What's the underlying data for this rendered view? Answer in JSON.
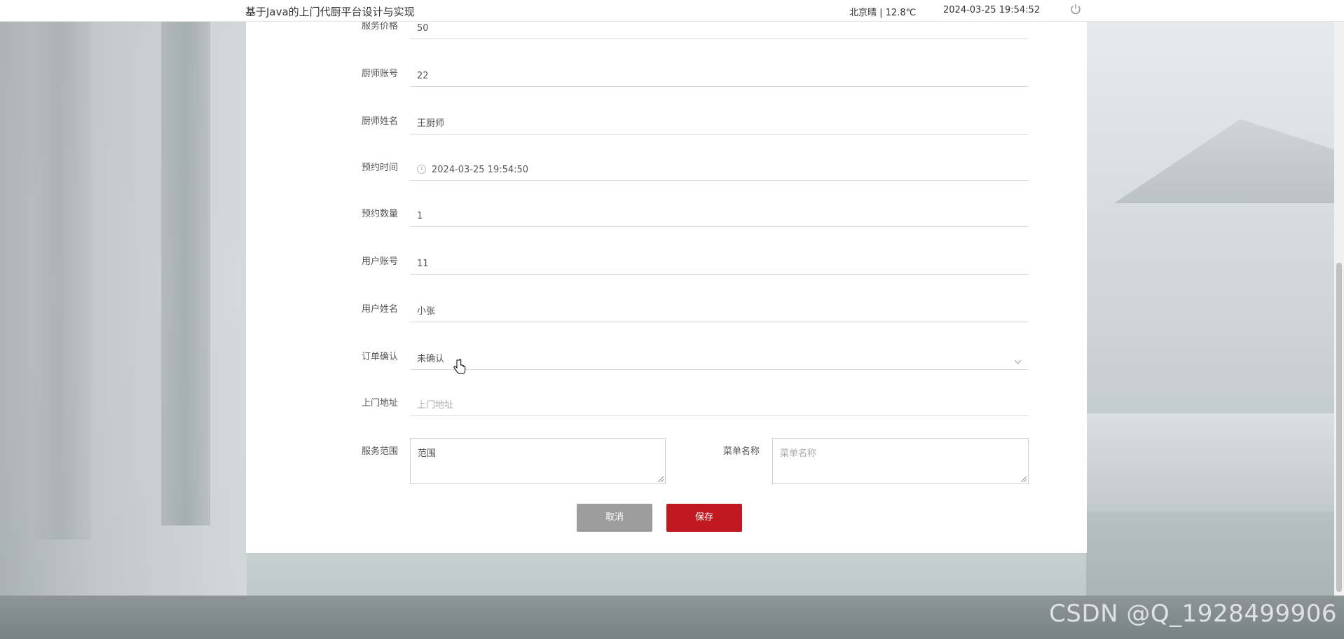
{
  "header": {
    "title": "基于Java的上门代厨平台设计与实现",
    "weather": "北京晴 | 12.8℃",
    "date": "2024-03-25",
    "time": "19:54:52",
    "power_icon": "power-icon"
  },
  "form": {
    "fields": [
      {
        "label": "服务价格",
        "value": "50"
      },
      {
        "label": "厨师账号",
        "value": "22"
      },
      {
        "label": "厨师姓名",
        "value": "王厨师"
      },
      {
        "label": "预约时间",
        "value": "2024-03-25 19:54:50",
        "icon": "clock-icon"
      },
      {
        "label": "预约数量",
        "value": "1"
      },
      {
        "label": "用户账号",
        "value": "11"
      },
      {
        "label": "用户姓名",
        "value": "小张"
      },
      {
        "label": "订单确认",
        "value": "未确认",
        "icon": "chevron-down-icon"
      },
      {
        "label": "上门地址",
        "value": "",
        "placeholder": "上门地址"
      }
    ],
    "textareas": [
      {
        "label": "服务范围",
        "value": "范围"
      },
      {
        "label": "菜单名称",
        "value": "",
        "placeholder": "菜单名称"
      }
    ],
    "buttons": {
      "cancel_label": "取消",
      "save_label": "保存"
    }
  },
  "watermark": "CSDN @Q_1928499906",
  "colors": {
    "primary": "#c0191f",
    "cancel": "#9c9c9c"
  }
}
